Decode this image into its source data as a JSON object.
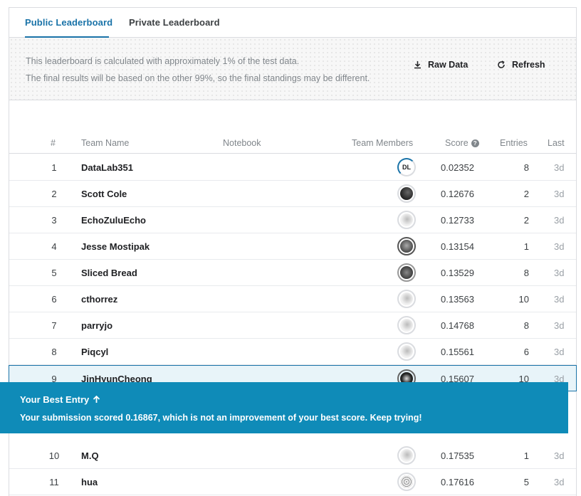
{
  "tabs": {
    "public_label": "Public Leaderboard",
    "private_label": "Private Leaderboard"
  },
  "info": {
    "line1": "This leaderboard is calculated with approximately 1% of the test data.",
    "line2": "The final results will be based on the other 99%, so the final standings may be different.",
    "raw_data_label": "Raw Data",
    "refresh_label": "Refresh"
  },
  "table": {
    "headers": {
      "rank": "#",
      "team": "Team Name",
      "notebook": "Notebook",
      "members": "Team Members",
      "score": "Score",
      "entries": "Entries",
      "last": "Last"
    },
    "rows": [
      {
        "rank": "1",
        "team": "DataLab351",
        "score": "0.02352",
        "entries": "8",
        "last": "3d"
      },
      {
        "rank": "2",
        "team": "Scott Cole",
        "score": "0.12676",
        "entries": "2",
        "last": "3d"
      },
      {
        "rank": "3",
        "team": "EchoZuluEcho",
        "score": "0.12733",
        "entries": "2",
        "last": "3d"
      },
      {
        "rank": "4",
        "team": "Jesse Mostipak",
        "score": "0.13154",
        "entries": "1",
        "last": "3d"
      },
      {
        "rank": "5",
        "team": "Sliced Bread",
        "score": "0.13529",
        "entries": "8",
        "last": "3d"
      },
      {
        "rank": "6",
        "team": "cthorrez",
        "score": "0.13563",
        "entries": "10",
        "last": "3d"
      },
      {
        "rank": "7",
        "team": "parryjo",
        "score": "0.14768",
        "entries": "8",
        "last": "3d"
      },
      {
        "rank": "8",
        "team": "Piqcyl",
        "score": "0.15561",
        "entries": "6",
        "last": "3d"
      },
      {
        "rank": "9",
        "team": "JinHyunCheong",
        "score": "0.15607",
        "entries": "10",
        "last": "3d"
      },
      {
        "rank": "10",
        "team": "M.Q",
        "score": "0.17535",
        "entries": "1",
        "last": "3d"
      },
      {
        "rank": "11",
        "team": "hua",
        "score": "0.17616",
        "entries": "5",
        "last": "3d"
      }
    ]
  },
  "best_entry": {
    "title": "Your Best Entry",
    "message": "Your submission scored 0.16867, which is not an improvement of your best score. Keep trying!"
  },
  "colors": {
    "accent": "#1a73a8",
    "banner": "#0f8bb8",
    "highlight_row": "#e8f4f9"
  }
}
